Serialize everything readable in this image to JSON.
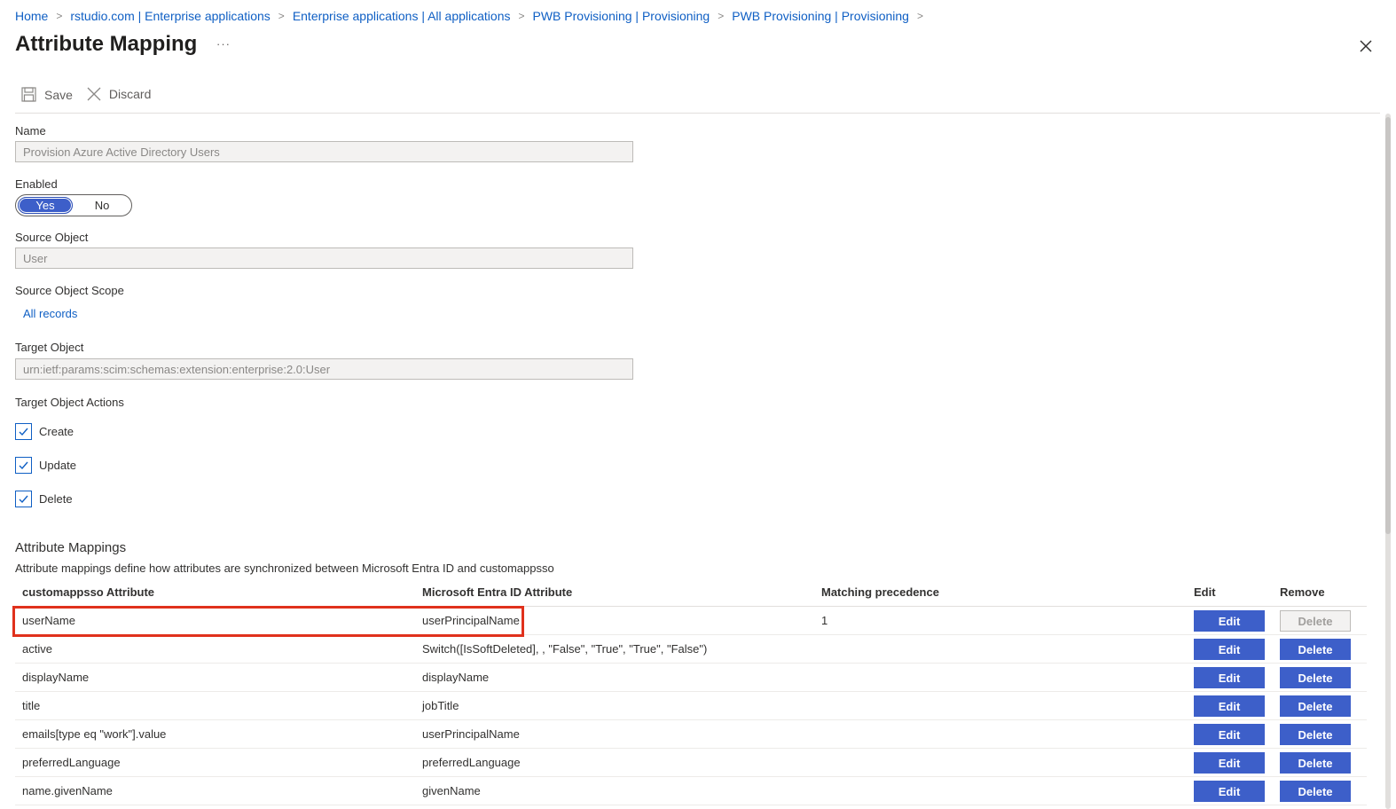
{
  "breadcrumb": [
    {
      "label": "Home"
    },
    {
      "label": "rstudio.com | Enterprise applications"
    },
    {
      "label": "Enterprise applications | All applications"
    },
    {
      "label": "PWB Provisioning | Provisioning"
    },
    {
      "label": "PWB Provisioning | Provisioning"
    }
  ],
  "page": {
    "title": "Attribute Mapping",
    "more": "···"
  },
  "toolbar": {
    "save_label": "Save",
    "discard_label": "Discard"
  },
  "form": {
    "name_label": "Name",
    "name_value": "Provision Azure Active Directory Users",
    "enabled_label": "Enabled",
    "enabled_yes": "Yes",
    "enabled_no": "No",
    "enabled_selected": "Yes",
    "source_object_label": "Source Object",
    "source_object_value": "User",
    "source_scope_label": "Source Object Scope",
    "source_scope_link": "All records",
    "target_object_label": "Target Object",
    "target_object_value": "urn:ietf:params:scim:schemas:extension:enterprise:2.0:User",
    "target_actions_label": "Target Object Actions",
    "actions": [
      {
        "label": "Create",
        "checked": true
      },
      {
        "label": "Update",
        "checked": true
      },
      {
        "label": "Delete",
        "checked": true
      }
    ]
  },
  "mappings": {
    "title": "Attribute Mappings",
    "description": "Attribute mappings define how attributes are synchronized between Microsoft Entra ID and customappsso",
    "columns": [
      "customappsso Attribute",
      "Microsoft Entra ID Attribute",
      "Matching precedence",
      "Edit",
      "Remove"
    ],
    "edit_label": "Edit",
    "delete_label": "Delete",
    "rows": [
      {
        "target": "userName",
        "source": "userPrincipalName",
        "precedence": "1",
        "delete_disabled": true
      },
      {
        "target": "active",
        "source": "Switch([IsSoftDeleted], , \"False\", \"True\", \"True\", \"False\")",
        "precedence": "",
        "delete_disabled": false
      },
      {
        "target": "displayName",
        "source": "displayName",
        "precedence": "",
        "delete_disabled": false
      },
      {
        "target": "title",
        "source": "jobTitle",
        "precedence": "",
        "delete_disabled": false
      },
      {
        "target": "emails[type eq \"work\"].value",
        "source": "userPrincipalName",
        "precedence": "",
        "delete_disabled": false
      },
      {
        "target": "preferredLanguage",
        "source": "preferredLanguage",
        "precedence": "",
        "delete_disabled": false
      },
      {
        "target": "name.givenName",
        "source": "givenName",
        "precedence": "",
        "delete_disabled": false
      }
    ]
  },
  "colors": {
    "accent": "#3d5fc9",
    "link": "#0f5fc4",
    "highlight": "#e0311c"
  }
}
